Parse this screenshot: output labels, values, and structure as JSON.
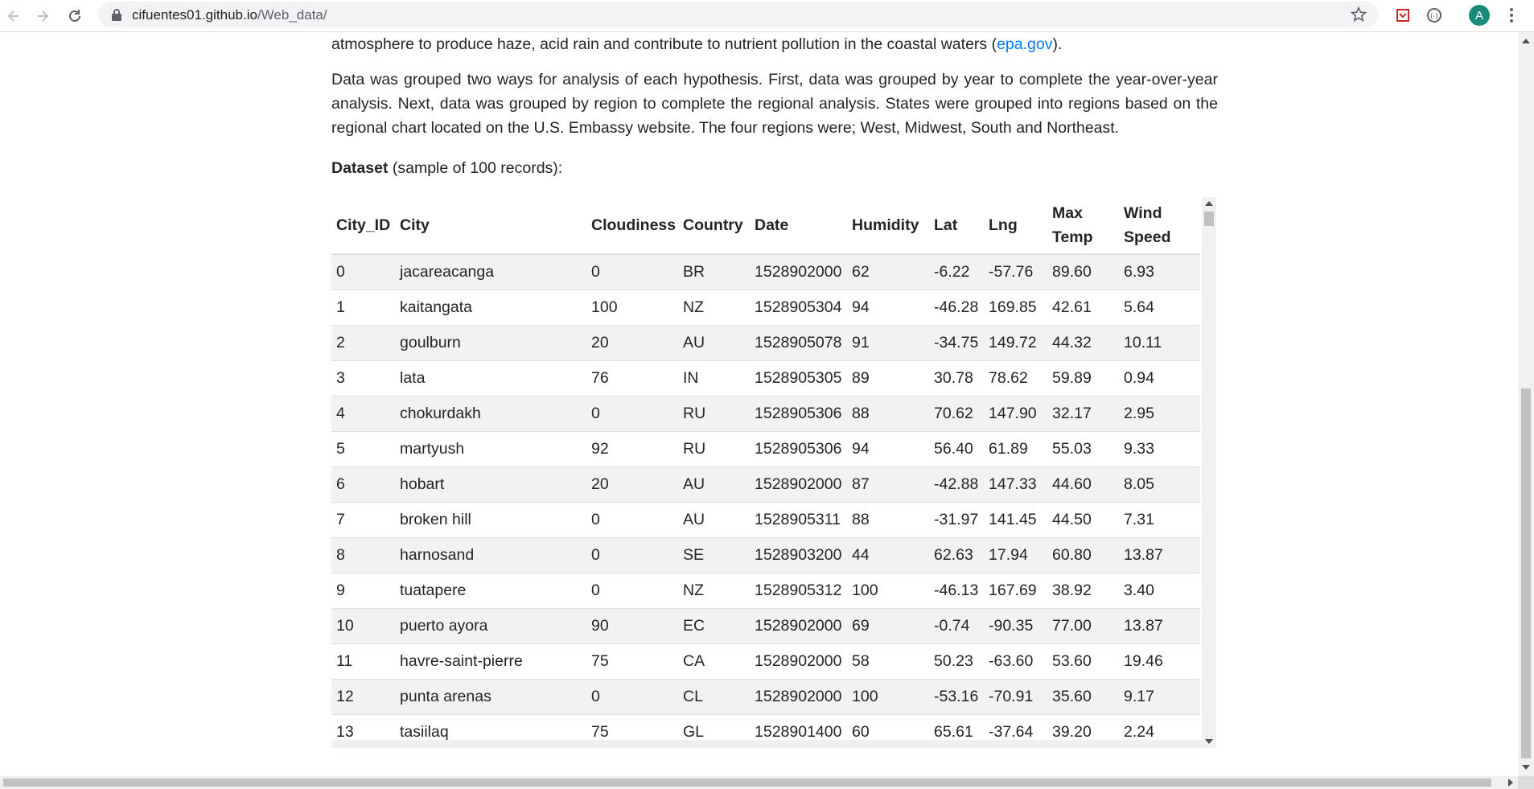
{
  "browser": {
    "url_host": "cifuentes01.github.io",
    "url_path": "/Web_data/",
    "avatar_letter": "A"
  },
  "article": {
    "para1_text": "atmosphere to produce haze, acid rain and contribute to nutrient pollution in the coastal waters (",
    "para1_link": "epa.gov",
    "para1_end": ").",
    "para2": "Data was grouped two ways for analysis of each hypothesis. First, data was grouped by year to complete the year-over-year analysis. Next, data was grouped by region to complete the regional analysis. States were grouped into regions based on the regional chart located on the U.S. Embassy website. The four regions were; West, Midwest, South and Northeast.",
    "dataset_label": "Dataset",
    "dataset_note": " (sample of 100 records):"
  },
  "table": {
    "headers": [
      "City_ID",
      "City",
      "Cloudiness",
      "Country",
      "Date",
      "Humidity",
      "Lat",
      "Lng",
      "Max Temp",
      "Wind Speed"
    ],
    "rows": [
      [
        "0",
        "jacareacanga",
        "0",
        "BR",
        "1528902000",
        "62",
        "-6.22",
        "-57.76",
        "89.60",
        "6.93"
      ],
      [
        "1",
        "kaitangata",
        "100",
        "NZ",
        "1528905304",
        "94",
        "-46.28",
        "169.85",
        "42.61",
        "5.64"
      ],
      [
        "2",
        "goulburn",
        "20",
        "AU",
        "1528905078",
        "91",
        "-34.75",
        "149.72",
        "44.32",
        "10.11"
      ],
      [
        "3",
        "lata",
        "76",
        "IN",
        "1528905305",
        "89",
        "30.78",
        "78.62",
        "59.89",
        "0.94"
      ],
      [
        "4",
        "chokurdakh",
        "0",
        "RU",
        "1528905306",
        "88",
        "70.62",
        "147.90",
        "32.17",
        "2.95"
      ],
      [
        "5",
        "martyush",
        "92",
        "RU",
        "1528905306",
        "94",
        "56.40",
        "61.89",
        "55.03",
        "9.33"
      ],
      [
        "6",
        "hobart",
        "20",
        "AU",
        "1528902000",
        "87",
        "-42.88",
        "147.33",
        "44.60",
        "8.05"
      ],
      [
        "7",
        "broken hill",
        "0",
        "AU",
        "1528905311",
        "88",
        "-31.97",
        "141.45",
        "44.50",
        "7.31"
      ],
      [
        "8",
        "harnosand",
        "0",
        "SE",
        "1528903200",
        "44",
        "62.63",
        "17.94",
        "60.80",
        "13.87"
      ],
      [
        "9",
        "tuatapere",
        "0",
        "NZ",
        "1528905312",
        "100",
        "-46.13",
        "167.69",
        "38.92",
        "3.40"
      ],
      [
        "10",
        "puerto ayora",
        "90",
        "EC",
        "1528902000",
        "69",
        "-0.74",
        "-90.35",
        "77.00",
        "13.87"
      ],
      [
        "11",
        "havre-saint-pierre",
        "75",
        "CA",
        "1528902000",
        "58",
        "50.23",
        "-63.60",
        "53.60",
        "19.46"
      ],
      [
        "12",
        "punta arenas",
        "0",
        "CL",
        "1528902000",
        "100",
        "-53.16",
        "-70.91",
        "35.60",
        "9.17"
      ],
      [
        "13",
        "tasiilaq",
        "75",
        "GL",
        "1528901400",
        "60",
        "65.61",
        "-37.64",
        "39.20",
        "2.24"
      ]
    ]
  },
  "colors": {
    "link": "#007bff",
    "stripe": "#f2f2f2",
    "avatar": "#1a8a7a"
  }
}
